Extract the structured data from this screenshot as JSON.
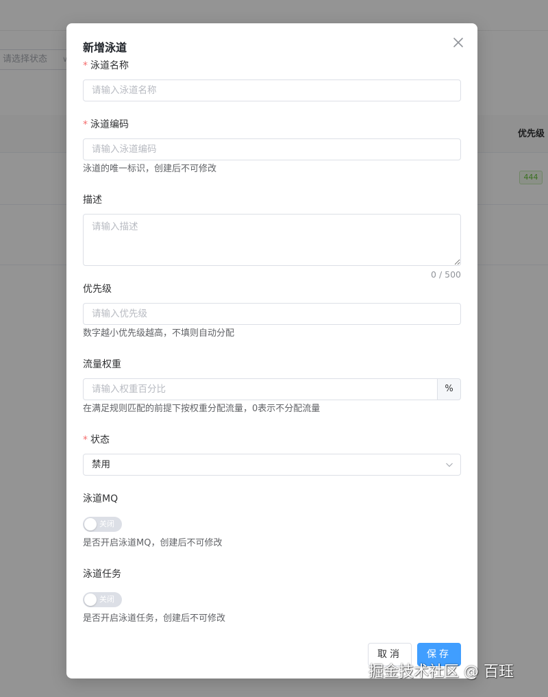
{
  "background": {
    "filter_placeholder": "请选择状态",
    "column_title": "优先级",
    "row_priority_tag": "444"
  },
  "dialog": {
    "title": "新增泳道",
    "fields": {
      "name": {
        "label": "泳道名称",
        "required": true,
        "placeholder": "请输入泳道名称",
        "value": ""
      },
      "code": {
        "label": "泳道编码",
        "required": true,
        "placeholder": "请输入泳道编码",
        "value": "",
        "hint": "泳道的唯一标识，创建后不可修改"
      },
      "description": {
        "label": "描述",
        "placeholder": "请输入描述",
        "value": "",
        "counter": "0 / 500"
      },
      "priority": {
        "label": "优先级",
        "placeholder": "请输入优先级",
        "value": "",
        "hint": "数字越小优先级越高，不填则自动分配"
      },
      "weight": {
        "label": "流量权重",
        "placeholder": "请输入权重百分比",
        "value": "",
        "unit": "%",
        "hint": "在满足规则匹配的前提下按权重分配流量，0表示不分配流量"
      },
      "status": {
        "label": "状态",
        "required": true,
        "selected": "禁用"
      },
      "mq": {
        "label": "泳道MQ",
        "switch_text": "关闭",
        "enabled": false,
        "hint": "是否开启泳道MQ，创建后不可修改"
      },
      "task": {
        "label": "泳道任务",
        "switch_text": "关闭",
        "enabled": false,
        "hint": "是否开启泳道任务，创建后不可修改"
      }
    },
    "buttons": {
      "cancel": "取消",
      "save": "保存"
    }
  },
  "watermark": "掘金技术社区 @ 百珏",
  "colors": {
    "primary": "#409eff",
    "required_mark": "#f56c6c",
    "overlay": "rgba(0,0,0,0.42)",
    "tag_green": "#67c23a"
  }
}
